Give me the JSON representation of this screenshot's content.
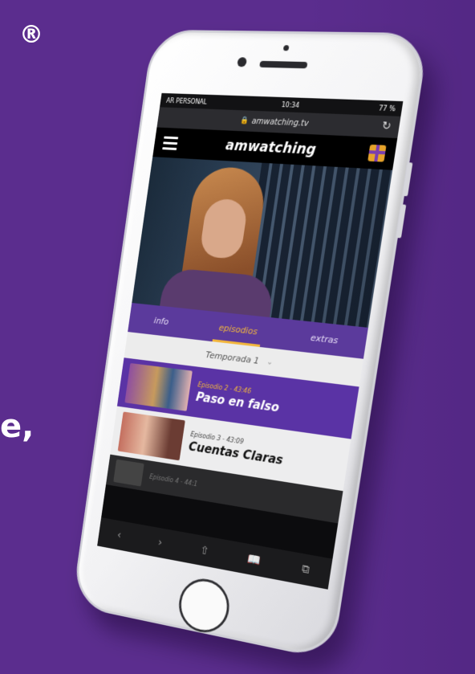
{
  "background": {
    "registered_mark": "®",
    "fragment_text": "e,"
  },
  "status_bar": {
    "carrier": "AR PERSONAL",
    "time": "10:34",
    "battery": "77 %"
  },
  "browser": {
    "url": "amwatching.tv"
  },
  "app": {
    "brand": "amwatching"
  },
  "tabs": [
    {
      "label": "info",
      "active": false
    },
    {
      "label": "episodios",
      "active": true
    },
    {
      "label": "extras",
      "active": false
    }
  ],
  "season": {
    "label": "Temporada 1"
  },
  "episodes": [
    {
      "subtitle": "Episodio 2 - 43:46",
      "title": "Paso en falso",
      "highlighted": true
    },
    {
      "subtitle": "Episodio 3 - 43:09",
      "title": "Cuentas Claras",
      "highlighted": false
    },
    {
      "subtitle": "Episodio 4 - 44:1",
      "title": ""
    }
  ],
  "colors": {
    "background": "#5b2d8e",
    "accent": "#f2b63d",
    "tab_bar": "#5b3a9c",
    "highlight_row": "#5a33a5"
  }
}
